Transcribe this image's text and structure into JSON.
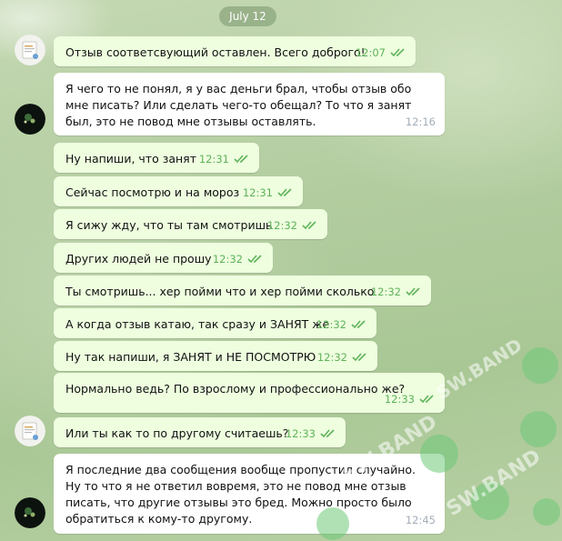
{
  "date_pill": "July 12",
  "messages": [
    {
      "text": "Отзыв соответсвующий оставлен. Всего доброго!",
      "time": "12:07",
      "dir": "out"
    },
    {
      "text": "Я чего то не понял, я у вас деньги брал, чтобы отзыв обо мне писать? Или сделать чего-то обещал? То что я занят был, это не повод мне отзывы оставлять.",
      "time": "12:16",
      "dir": "in"
    },
    {
      "text": "Ну напиши, что занят",
      "time": "12:31",
      "dir": "out"
    },
    {
      "text": "Сейчас посмотрю и на мороз",
      "time": "12:31",
      "dir": "out"
    },
    {
      "text": "Я сижу жду, что ты там смотришь",
      "time": "12:32",
      "dir": "out"
    },
    {
      "text": "Других людей не прошу",
      "time": "12:32",
      "dir": "out"
    },
    {
      "text": "Ты смотришь... хер пойми что и хер пойми сколько",
      "time": "12:32",
      "dir": "out"
    },
    {
      "text": "А когда отзыв катаю, так сразу и ЗАНЯТ же",
      "time": "12:32",
      "dir": "out"
    },
    {
      "text": "Ну так напиши, я ЗАНЯТ и НЕ ПОСМОТРЮ",
      "time": "12:32",
      "dir": "out"
    },
    {
      "text": "Нормально ведь? По взрослому и профессионально же?",
      "time": "12:33",
      "dir": "out"
    },
    {
      "text": "Или ты как то по другому считаешь?",
      "time": "12:33",
      "dir": "out"
    },
    {
      "text": "Я последние два сообщения вообще пропустил случайно. Ну то что я не ответил вовремя, это не повод мне отзыв писать, что другие отзывы это бред. Можно просто было обратиться к кому-то другому.",
      "time": "12:45",
      "dir": "in"
    }
  ],
  "watermark": {
    "text": "SW.BAND"
  },
  "colors": {
    "outgoing_bubble": "#eefedf",
    "incoming_bubble": "#ffffff",
    "check": "#5fb35a",
    "time_in": "#a3adb8"
  }
}
